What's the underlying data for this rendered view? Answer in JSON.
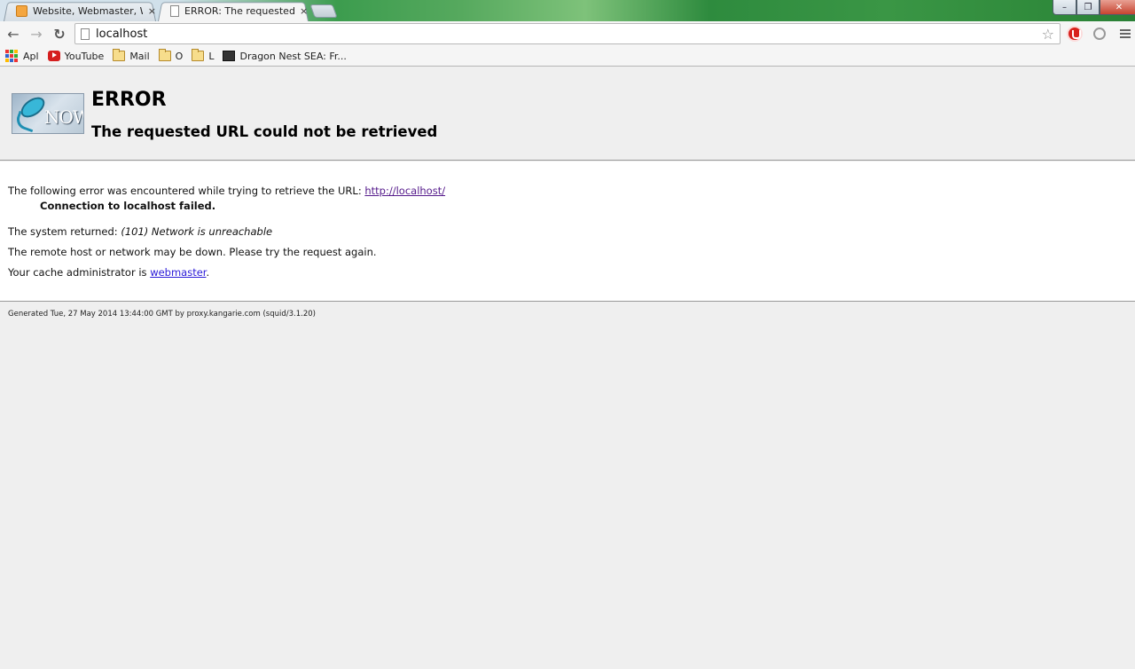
{
  "browser": {
    "tabs": [
      {
        "label": "Website, Webmaster, Web",
        "close": "×",
        "active": false
      },
      {
        "label": "ERROR: The requested URL",
        "close": "×",
        "active": true
      }
    ],
    "window_controls": {
      "minimize": "–",
      "maximize": "❐",
      "close": "✕"
    }
  },
  "toolbar": {
    "back": "←",
    "forward": "→",
    "reload": "↻",
    "address": "localhost",
    "star": "☆"
  },
  "bookmarks": [
    {
      "label": "Apl",
      "icon": "apps-icon"
    },
    {
      "label": "YouTube",
      "icon": "youtube-icon"
    },
    {
      "label": "Mail",
      "icon": "folder-icon"
    },
    {
      "label": "O",
      "icon": "folder-icon"
    },
    {
      "label": "L",
      "icon": "folder-icon"
    },
    {
      "label": "Dragon Nest SEA: Fr...",
      "icon": "dragon-nest-icon"
    }
  ],
  "page": {
    "logo_text": "NOW",
    "title": "ERROR",
    "subtitle": "The requested URL could not be retrieved",
    "line1_prefix": "The following error was encountered while trying to retrieve the URL: ",
    "line1_link": "http://localhost/",
    "error_message": "Connection to localhost failed.",
    "system_prefix": "The system returned: ",
    "system_value": "(101) Network is unreachable",
    "remote_line": "The remote host or network may be down. Please try the request again.",
    "admin_prefix": "Your cache administrator is ",
    "admin_link": "webmaster",
    "admin_suffix": ".",
    "footer": "Generated Tue, 27 May 2014 13:44:00 GMT by proxy.kangarie.com (squid/3.1.20)"
  },
  "colors": {
    "visited_link": "#551a8b",
    "link": "#2a1ad8",
    "background": "#efefef"
  }
}
